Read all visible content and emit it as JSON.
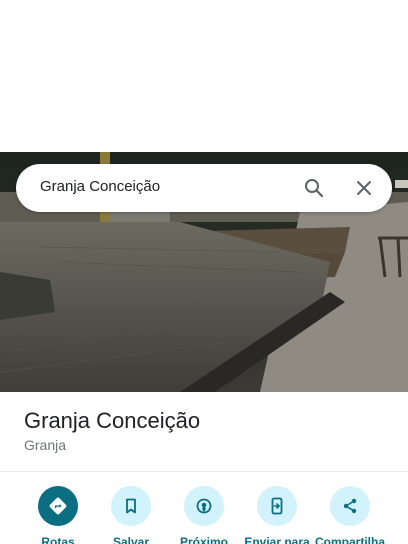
{
  "search": {
    "query": "Granja Conceição"
  },
  "place": {
    "title": "Granja Conceição",
    "category": "Granja"
  },
  "actions": [
    {
      "label": "Rotas",
      "icon": "directions-icon"
    },
    {
      "label": "Salvar",
      "icon": "bookmark-icon"
    },
    {
      "label": "Próximo",
      "icon": "nearby-icon"
    },
    {
      "label": "Enviar para",
      "icon": "send-to-device-icon"
    },
    {
      "label": "Compartilha",
      "icon": "share-icon"
    }
  ],
  "colors": {
    "accent": "#0b6e83",
    "action_bg": "#d2f3fb",
    "subtitle": "#70757a"
  }
}
